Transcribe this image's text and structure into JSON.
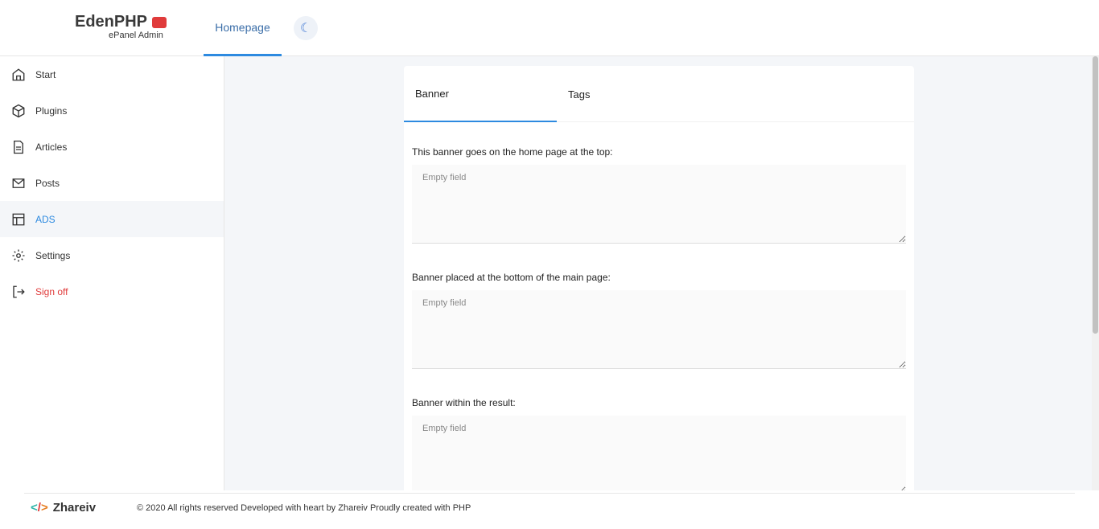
{
  "header": {
    "brand": "EdenPHP",
    "subtitle": "ePanel Admin",
    "nav": "Homepage"
  },
  "sidebar": {
    "items": [
      {
        "label": "Start"
      },
      {
        "label": "Plugins"
      },
      {
        "label": "Articles"
      },
      {
        "label": "Posts"
      },
      {
        "label": "ADS"
      },
      {
        "label": "Settings"
      },
      {
        "label": "Sign off"
      }
    ]
  },
  "tabs": [
    "Banner",
    "Tags"
  ],
  "fields": [
    {
      "label": "This banner goes on the home page at the top:",
      "placeholder": "Empty field"
    },
    {
      "label": "Banner placed at the bottom of the main page:",
      "placeholder": "Empty field"
    },
    {
      "label": "Banner within the result:",
      "placeholder": "Empty field"
    }
  ],
  "footer": {
    "brand": "Zhareiv",
    "text": "© 2020 All rights reserved Developed with heart by Zhareiv Proudly created with PHP"
  }
}
